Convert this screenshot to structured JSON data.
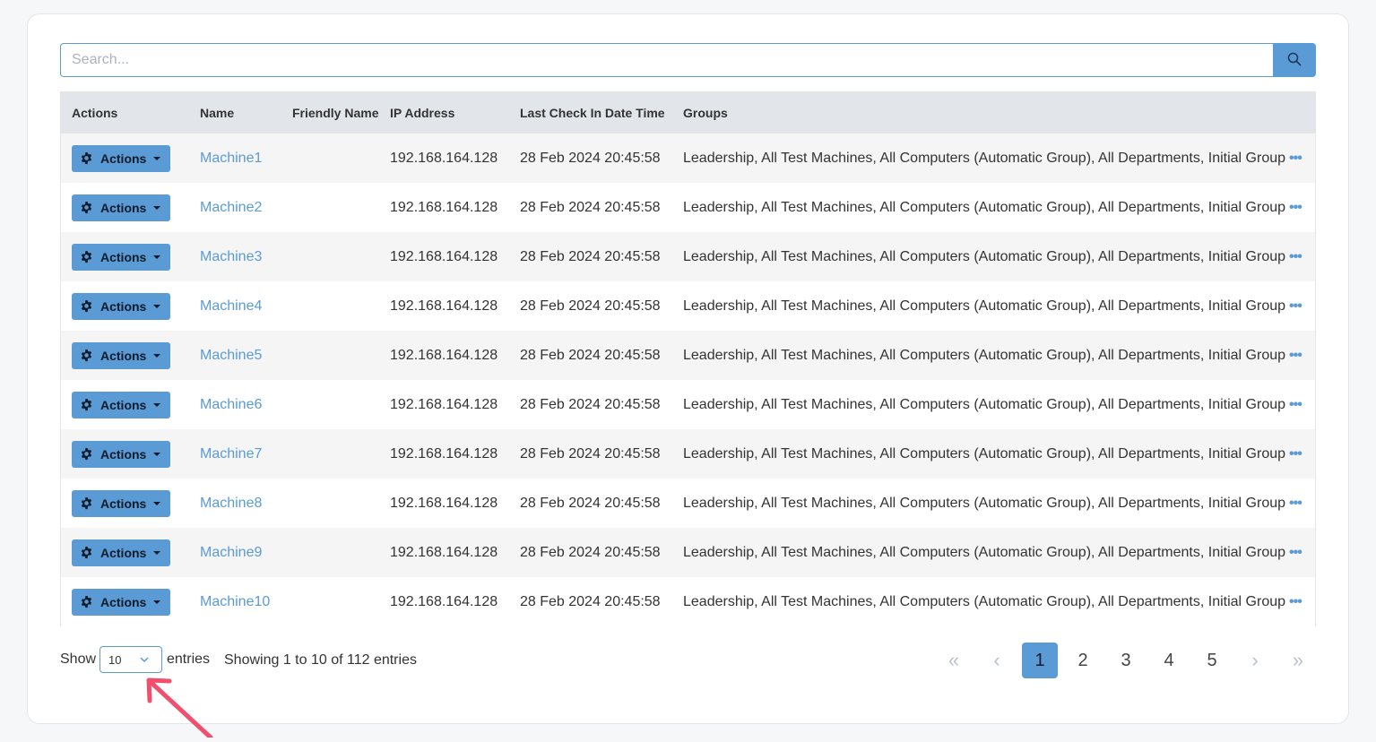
{
  "search": {
    "placeholder": "Search..."
  },
  "columns": [
    "Actions",
    "Name",
    "Friendly Name",
    "IP Address",
    "Last Check In Date Time",
    "Groups"
  ],
  "rows": [
    {
      "action": "Actions",
      "name": "Machine1",
      "friendly": "",
      "ip": "192.168.164.128",
      "checkin": "28 Feb 2024 20:45:58",
      "groups": "Leadership, All Test Machines, All Computers (Automatic Group), All Departments, Initial Group"
    },
    {
      "action": "Actions",
      "name": "Machine2",
      "friendly": "",
      "ip": "192.168.164.128",
      "checkin": "28 Feb 2024 20:45:58",
      "groups": "Leadership, All Test Machines, All Computers (Automatic Group), All Departments, Initial Group"
    },
    {
      "action": "Actions",
      "name": "Machine3",
      "friendly": "",
      "ip": "192.168.164.128",
      "checkin": "28 Feb 2024 20:45:58",
      "groups": "Leadership, All Test Machines, All Computers (Automatic Group), All Departments, Initial Group"
    },
    {
      "action": "Actions",
      "name": "Machine4",
      "friendly": "",
      "ip": "192.168.164.128",
      "checkin": "28 Feb 2024 20:45:58",
      "groups": "Leadership, All Test Machines, All Computers (Automatic Group), All Departments, Initial Group"
    },
    {
      "action": "Actions",
      "name": "Machine5",
      "friendly": "",
      "ip": "192.168.164.128",
      "checkin": "28 Feb 2024 20:45:58",
      "groups": "Leadership, All Test Machines, All Computers (Automatic Group), All Departments, Initial Group"
    },
    {
      "action": "Actions",
      "name": "Machine6",
      "friendly": "",
      "ip": "192.168.164.128",
      "checkin": "28 Feb 2024 20:45:58",
      "groups": "Leadership, All Test Machines, All Computers (Automatic Group), All Departments, Initial Group"
    },
    {
      "action": "Actions",
      "name": "Machine7",
      "friendly": "",
      "ip": "192.168.164.128",
      "checkin": "28 Feb 2024 20:45:58",
      "groups": "Leadership, All Test Machines, All Computers (Automatic Group), All Departments, Initial Group"
    },
    {
      "action": "Actions",
      "name": "Machine8",
      "friendly": "",
      "ip": "192.168.164.128",
      "checkin": "28 Feb 2024 20:45:58",
      "groups": "Leadership, All Test Machines, All Computers (Automatic Group), All Departments, Initial Group"
    },
    {
      "action": "Actions",
      "name": "Machine9",
      "friendly": "",
      "ip": "192.168.164.128",
      "checkin": "28 Feb 2024 20:45:58",
      "groups": "Leadership, All Test Machines, All Computers (Automatic Group), All Departments, Initial Group"
    },
    {
      "action": "Actions",
      "name": "Machine10",
      "friendly": "",
      "ip": "192.168.164.128",
      "checkin": "28 Feb 2024 20:45:58",
      "groups": "Leadership, All Test Machines, All Computers (Automatic Group), All Departments, Initial Group"
    }
  ],
  "footer": {
    "show_label": "Show",
    "page_size": "10",
    "entries_label": "entries",
    "info": "Showing 1 to 10 of 112 entries"
  },
  "pagination": {
    "first": "«",
    "prev": "‹",
    "pages": [
      "1",
      "2",
      "3",
      "4",
      "5"
    ],
    "current": "1",
    "next": "›",
    "last": "»"
  },
  "icons": {
    "search": "search-icon",
    "gear": "gear-icon",
    "more": "ellipsis-icon",
    "dropdown": "chevron-down-icon",
    "annotation": "arrow-annotation"
  },
  "colors": {
    "accent": "#5b9bd5",
    "header_bg": "#e2e5e9",
    "annotation": "#f0506e"
  }
}
